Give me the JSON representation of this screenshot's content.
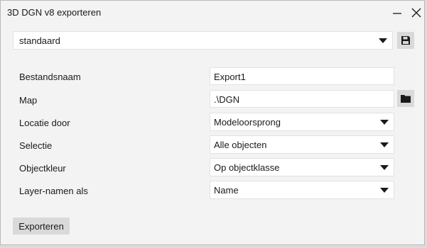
{
  "window": {
    "title": "3D DGN v8 exporteren"
  },
  "profile": {
    "selected": "standaard",
    "save_icon": "save-disk-icon"
  },
  "form": {
    "filename_label": "Bestandsnaam",
    "filename_value": "Export1",
    "folder_label": "Map",
    "folder_value": ".\\DGN",
    "folder_icon": "folder-icon",
    "location_label": "Locatie door",
    "location_value": "Modeloorsprong",
    "selection_label": "Selectie",
    "selection_value": "Alle objecten",
    "color_label": "Objectkleur",
    "color_value": "Op objectklasse",
    "layer_label": "Layer-namen als",
    "layer_value": "Name"
  },
  "actions": {
    "export_label": "Exporteren"
  },
  "colors": {
    "window_bg": "#f3f3f3",
    "field_bg": "#ffffff",
    "button_bg": "#d9d9d9",
    "text": "#1a1a1a"
  }
}
